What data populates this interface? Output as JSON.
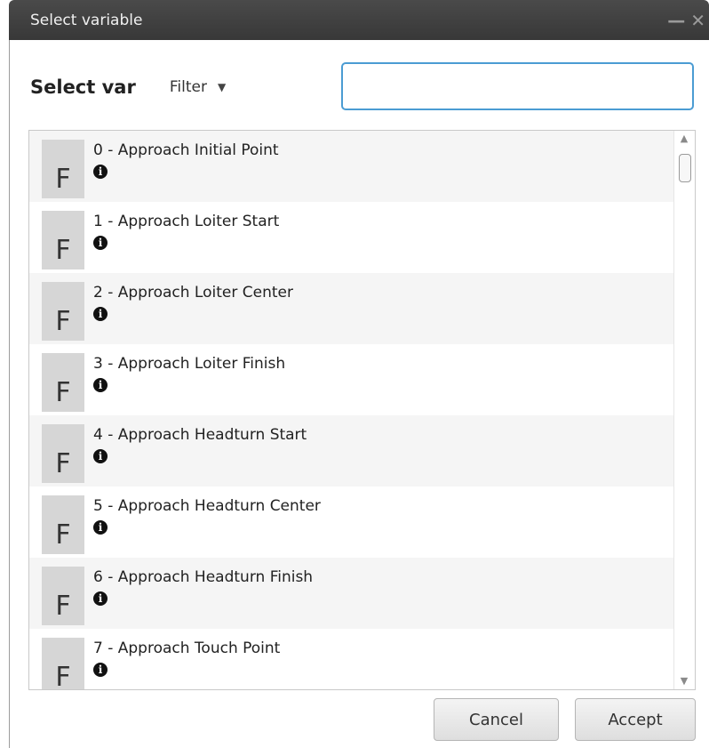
{
  "window": {
    "title": "Select variable",
    "minimize_glyph": "—",
    "close_glyph": "✕"
  },
  "header": {
    "heading": "Select var",
    "filter_label": "Filter",
    "search_value": "",
    "search_placeholder": ""
  },
  "list": {
    "items": [
      {
        "type_letter": "F",
        "label": "0 - Approach Initial Point"
      },
      {
        "type_letter": "F",
        "label": "1 - Approach Loiter Start"
      },
      {
        "type_letter": "F",
        "label": "2 - Approach Loiter Center"
      },
      {
        "type_letter": "F",
        "label": "3 - Approach Loiter Finish"
      },
      {
        "type_letter": "F",
        "label": "4 - Approach Headturn Start"
      },
      {
        "type_letter": "F",
        "label": "5 - Approach Headturn Center"
      },
      {
        "type_letter": "F",
        "label": "6 - Approach Headturn Finish"
      },
      {
        "type_letter": "F",
        "label": "7 - Approach Touch Point"
      }
    ],
    "info_icon": "info-icon"
  },
  "footer": {
    "cancel_label": "Cancel",
    "accept_label": "Accept"
  },
  "colors": {
    "titlebar": "#3c3c3c",
    "focus_border": "#4b9cd3",
    "type_badge": "#d6d6d6"
  }
}
